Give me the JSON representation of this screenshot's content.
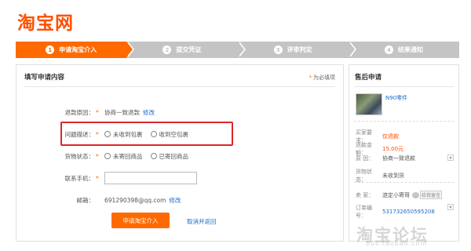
{
  "logo": "淘宝网",
  "steps": [
    {
      "num": "1",
      "label": "申请淘宝介入"
    },
    {
      "num": "2",
      "label": "提交凭证"
    },
    {
      "num": "3",
      "label": "评审判定"
    },
    {
      "num": "4",
      "label": "结果通知"
    }
  ],
  "main": {
    "title": "填写申请内容",
    "required_note": "为必填项",
    "required_mark": "*",
    "refund_reason_label": "退款原因：",
    "refund_reason_value": "协商一致退款",
    "refund_reason_edit": "修改",
    "problem_label": "问题描述：",
    "problem_options": [
      "未收到包裹",
      "收到空包裹"
    ],
    "goods_status_label": "货物状态：",
    "goods_status_options": [
      "未寄回商品",
      "已寄回商品"
    ],
    "phone_label": "联系手机：",
    "email_label": "邮箱：",
    "email_value": "691290398@qq.com",
    "email_edit": "修改",
    "submit": "申请淘宝介入",
    "cancel": "取消并返回"
  },
  "side": {
    "title": "售后申请",
    "product_name": "N90零件",
    "buyer_req_label": "买家要求：",
    "buyer_req_value": "仅退款",
    "refund_amount_label": "退款金额：",
    "refund_amount_value": "15.00元",
    "reason_label": "原    因：",
    "reason_value": "协商一致退款",
    "goods_status_label": "货物状态：",
    "goods_status_value": "未收到货",
    "seller_label": "卖    家：",
    "seller_value": "涟定小寄哥",
    "seller_badge": "给我留言",
    "order_label": "订单编号：",
    "order_value": "531732650595208"
  },
  "watermark": "淘宝论坛",
  "watermark_sub": "bbs.taobao.com"
}
